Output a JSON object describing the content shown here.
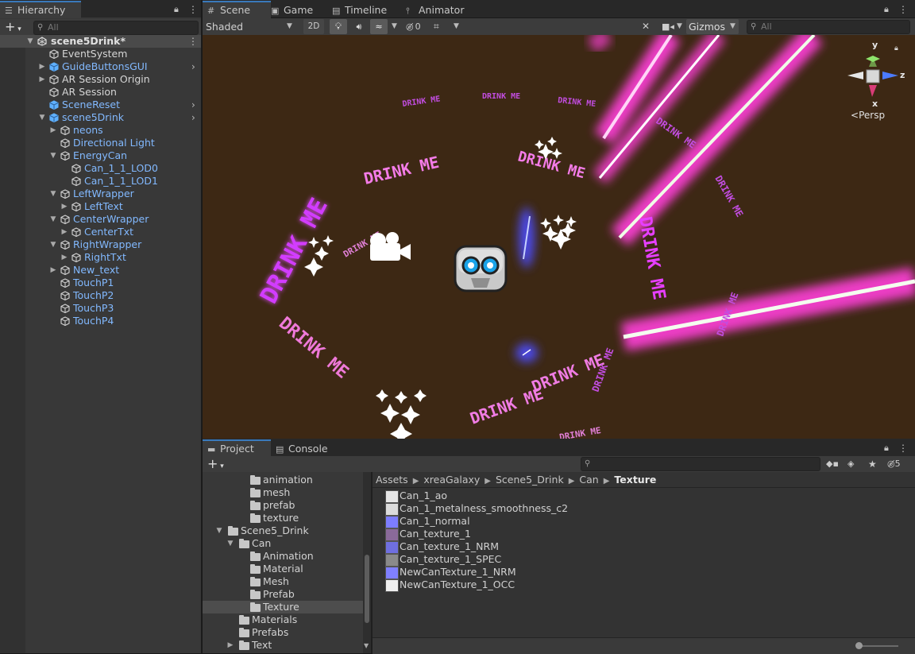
{
  "hierarchy": {
    "tab_label": "Hierarchy",
    "search_placeholder": "All",
    "scene_name": "scene5Drink*",
    "items": [
      {
        "label": "EventSystem",
        "color": "white",
        "prefab": false,
        "arrow": "",
        "chev": false
      },
      {
        "label": "GuideButtonsGUI",
        "color": "blue",
        "prefab": true,
        "arrow": "right",
        "chev": true
      },
      {
        "label": "AR Session Origin",
        "color": "white",
        "prefab": false,
        "arrow": "right",
        "chev": false
      },
      {
        "label": "AR Session",
        "color": "white",
        "prefab": false,
        "arrow": "",
        "chev": false
      },
      {
        "label": "SceneReset",
        "color": "blue",
        "prefab": true,
        "arrow": "",
        "chev": true
      },
      {
        "label": "scene5Drink",
        "color": "blue",
        "prefab": true,
        "arrow": "down",
        "chev": true
      },
      {
        "label": "neons",
        "color": "blue",
        "prefab": false,
        "arrow": "right",
        "chev": false
      },
      {
        "label": "Directional Light",
        "color": "blue",
        "prefab": false,
        "arrow": "",
        "chev": false
      },
      {
        "label": "EnergyCan",
        "color": "blue",
        "prefab": false,
        "arrow": "down",
        "chev": false
      },
      {
        "label": "Can_1_1_LOD0",
        "color": "blue",
        "prefab": false,
        "arrow": "",
        "chev": false
      },
      {
        "label": "Can_1_1_LOD1",
        "color": "blue",
        "prefab": false,
        "arrow": "",
        "chev": false
      },
      {
        "label": "LeftWrapper",
        "color": "blue",
        "prefab": false,
        "arrow": "down",
        "chev": false
      },
      {
        "label": "LeftText",
        "color": "blue",
        "prefab": false,
        "arrow": "right",
        "chev": false
      },
      {
        "label": "CenterWrapper",
        "color": "blue",
        "prefab": false,
        "arrow": "down",
        "chev": false
      },
      {
        "label": "CenterTxt",
        "color": "blue",
        "prefab": false,
        "arrow": "right",
        "chev": false
      },
      {
        "label": "RightWrapper",
        "color": "blue",
        "prefab": false,
        "arrow": "down",
        "chev": false
      },
      {
        "label": "RightTxt",
        "color": "blue",
        "prefab": false,
        "arrow": "right",
        "chev": false
      },
      {
        "label": "New_text",
        "color": "blue",
        "prefab": false,
        "arrow": "right",
        "chev": false
      },
      {
        "label": "TouchP1",
        "color": "blue",
        "prefab": false,
        "arrow": "",
        "chev": false
      },
      {
        "label": "TouchP2",
        "color": "blue",
        "prefab": false,
        "arrow": "",
        "chev": false
      },
      {
        "label": "TouchP3",
        "color": "blue",
        "prefab": false,
        "arrow": "",
        "chev": false
      },
      {
        "label": "TouchP4",
        "color": "blue",
        "prefab": false,
        "arrow": "",
        "chev": false
      }
    ]
  },
  "scene_tabs": {
    "scene": "Scene",
    "game": "Game",
    "timeline": "Timeline",
    "animator": "Animator"
  },
  "scene_toolbar": {
    "shading_mode": "Shaded",
    "mode_2d": "2D",
    "hidden_count": "0",
    "gizmos": "Gizmos",
    "search_placeholder": "All"
  },
  "scene_view": {
    "text": "DRINK ME",
    "camera_mode": "Persp",
    "axis_y": "y",
    "axis_z": "z",
    "axis_x": "x"
  },
  "bottom_tabs": {
    "project": "Project",
    "console": "Console",
    "hidden_count": "5"
  },
  "project_tree": [
    {
      "label": "animation",
      "arrow": ""
    },
    {
      "label": "mesh",
      "arrow": ""
    },
    {
      "label": "prefab",
      "arrow": ""
    },
    {
      "label": "texture",
      "arrow": ""
    },
    {
      "label": "Scene5_Drink",
      "arrow": "down"
    },
    {
      "label": "Can",
      "arrow": "down"
    },
    {
      "label": "Animation",
      "arrow": ""
    },
    {
      "label": "Material",
      "arrow": ""
    },
    {
      "label": "Mesh",
      "arrow": ""
    },
    {
      "label": "Prefab",
      "arrow": ""
    },
    {
      "label": "Texture",
      "arrow": "",
      "selected": true
    },
    {
      "label": "Materials",
      "arrow": ""
    },
    {
      "label": "Prefabs",
      "arrow": ""
    },
    {
      "label": "Text",
      "arrow": "right"
    }
  ],
  "breadcrumb": [
    "Assets",
    "xreaGalaxy",
    "Scene5_Drink",
    "Can",
    "Texture"
  ],
  "assets": [
    {
      "label": "Can_1_ao",
      "thumb": "#e6e6e6"
    },
    {
      "label": "Can_1_metalness_smoothness_c2",
      "thumb": "#dcdcdc"
    },
    {
      "label": "Can_1_normal",
      "thumb": "#7d7dff"
    },
    {
      "label": "Can_texture_1",
      "thumb": "#8a6a9a"
    },
    {
      "label": "Can_texture_1_NRM",
      "thumb": "#6f6fe0"
    },
    {
      "label": "Can_texture_1_SPEC",
      "thumb": "#8a8a8a"
    },
    {
      "label": "NewCanTexture_1_NRM",
      "thumb": "#8080ff"
    },
    {
      "label": "NewCanTexture_1_OCC",
      "thumb": "#efefef"
    }
  ],
  "colors": {
    "accent": "#3a79bb",
    "prefab_blue": "#82b9ff",
    "scene_bg": "#3d2814",
    "neon_pink": "#ff3fd8"
  }
}
